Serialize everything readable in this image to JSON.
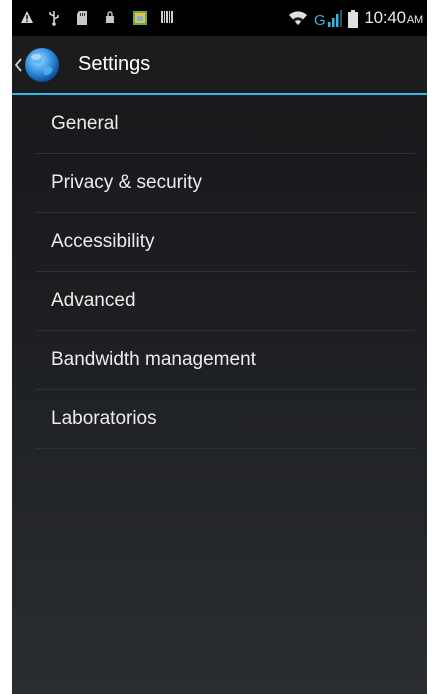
{
  "status_bar": {
    "time": "10:40",
    "ampm": "AM",
    "network": "G",
    "icons": [
      "warning-icon",
      "usb-icon",
      "sd-card-icon",
      "lock-icon",
      "gallery-icon",
      "barcode-icon",
      "wifi-icon",
      "signal-icon",
      "battery-icon"
    ]
  },
  "action_bar": {
    "title": "Settings",
    "accent_color": "#33b5e5",
    "icon": "globe-icon"
  },
  "settings": {
    "items": [
      {
        "label": "General"
      },
      {
        "label": "Privacy & security"
      },
      {
        "label": "Accessibility"
      },
      {
        "label": "Advanced"
      },
      {
        "label": "Bandwidth management"
      },
      {
        "label": "Laboratorios"
      }
    ]
  }
}
